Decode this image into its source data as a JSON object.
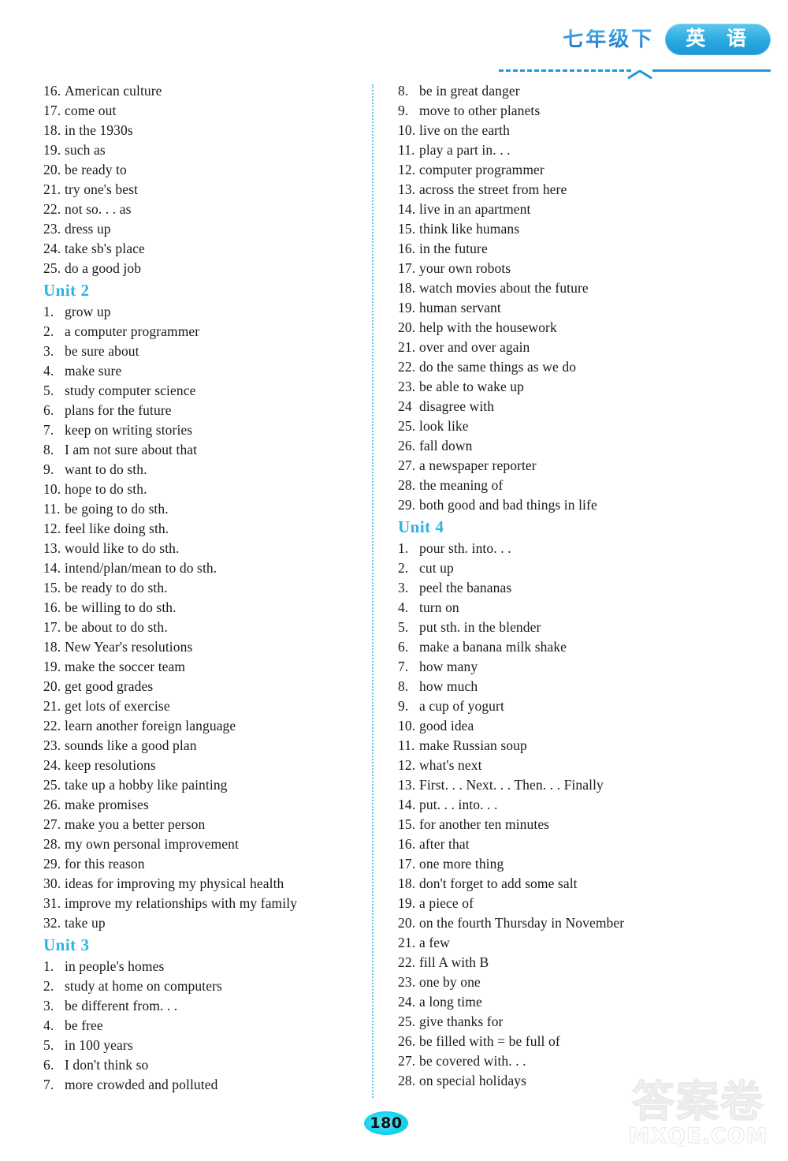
{
  "header": {
    "grade": "七年级下",
    "subject": "英 语"
  },
  "footer": {
    "page_number": "180",
    "watermark_cn": "答案卷",
    "watermark_domain": "MXQE.COM"
  },
  "colors": {
    "accent_blue": "#2bb3e6",
    "header_blue": "#1f7fd0",
    "divider": "#63c6ea",
    "page_badge": "#17d2ee",
    "text": "#1a1a1a"
  },
  "left_column": [
    {
      "type": "entry",
      "num": "16.",
      "text": "American culture"
    },
    {
      "type": "entry",
      "num": "17.",
      "text": "come out"
    },
    {
      "type": "entry",
      "num": "18.",
      "text": "in the 1930s"
    },
    {
      "type": "entry",
      "num": "19.",
      "text": "such as"
    },
    {
      "type": "entry",
      "num": "20.",
      "text": "be ready to"
    },
    {
      "type": "entry",
      "num": "21.",
      "text": "try one's best"
    },
    {
      "type": "entry",
      "num": "22.",
      "text": "not so. . . as"
    },
    {
      "type": "entry",
      "num": "23.",
      "text": "dress up"
    },
    {
      "type": "entry",
      "num": "24.",
      "text": "take sb's place"
    },
    {
      "type": "entry",
      "num": "25.",
      "text": "do a good job"
    },
    {
      "type": "unit",
      "label": "Unit",
      "num": "2"
    },
    {
      "type": "entry",
      "num": "1.",
      "text": "grow up"
    },
    {
      "type": "entry",
      "num": "2.",
      "text": "a computer programmer"
    },
    {
      "type": "entry",
      "num": "3.",
      "text": "be sure about"
    },
    {
      "type": "entry",
      "num": "4.",
      "text": "make sure"
    },
    {
      "type": "entry",
      "num": "5.",
      "text": "study computer science"
    },
    {
      "type": "entry",
      "num": "6.",
      "text": "plans for the future"
    },
    {
      "type": "entry",
      "num": "7.",
      "text": "keep on writing stories"
    },
    {
      "type": "entry",
      "num": "8.",
      "text": "I am not sure about that"
    },
    {
      "type": "entry",
      "num": "9.",
      "text": "want to do sth."
    },
    {
      "type": "entry",
      "num": "10.",
      "text": "hope to do sth."
    },
    {
      "type": "entry",
      "num": "11.",
      "text": "be going to do sth."
    },
    {
      "type": "entry",
      "num": "12.",
      "text": "feel like doing sth."
    },
    {
      "type": "entry",
      "num": "13.",
      "text": "would like to do sth."
    },
    {
      "type": "entry",
      "num": "14.",
      "text": "intend/plan/mean to do sth."
    },
    {
      "type": "entry",
      "num": "15.",
      "text": "be ready to do sth."
    },
    {
      "type": "entry",
      "num": "16.",
      "text": "be willing to do sth."
    },
    {
      "type": "entry",
      "num": "17.",
      "text": "be about to do sth."
    },
    {
      "type": "entry",
      "num": "18.",
      "text": "New Year's resolutions"
    },
    {
      "type": "entry",
      "num": "19.",
      "text": "make the soccer team"
    },
    {
      "type": "entry",
      "num": "20.",
      "text": "get good grades"
    },
    {
      "type": "entry",
      "num": "21.",
      "text": "get lots of exercise"
    },
    {
      "type": "entry",
      "num": "22.",
      "text": "learn another foreign language"
    },
    {
      "type": "entry",
      "num": "23.",
      "text": "sounds like a good plan"
    },
    {
      "type": "entry",
      "num": "24.",
      "text": "keep resolutions"
    },
    {
      "type": "entry",
      "num": "25.",
      "text": "take up a hobby like painting"
    },
    {
      "type": "entry",
      "num": "26.",
      "text": "make promises"
    },
    {
      "type": "entry",
      "num": "27.",
      "text": "make you a better person"
    },
    {
      "type": "entry",
      "num": "28.",
      "text": "my own personal improvement"
    },
    {
      "type": "entry",
      "num": "29.",
      "text": "for this reason"
    },
    {
      "type": "entry",
      "num": "30.",
      "text": "ideas for improving my physical health"
    },
    {
      "type": "entry",
      "num": "31.",
      "text": "improve my relationships with my family"
    },
    {
      "type": "entry",
      "num": "32.",
      "text": "take up"
    },
    {
      "type": "unit",
      "label": "Unit",
      "num": "3"
    },
    {
      "type": "entry",
      "num": "1.",
      "text": "in people's homes"
    },
    {
      "type": "entry",
      "num": "2.",
      "text": "study at home on computers"
    },
    {
      "type": "entry",
      "num": "3.",
      "text": "be different from. . ."
    },
    {
      "type": "entry",
      "num": "4.",
      "text": "be free"
    },
    {
      "type": "entry",
      "num": "5.",
      "text": "in 100 years"
    },
    {
      "type": "entry",
      "num": "6.",
      "text": "I don't think so"
    },
    {
      "type": "entry",
      "num": "7.",
      "text": "more crowded and polluted"
    }
  ],
  "right_column": [
    {
      "type": "entry",
      "num": "8.",
      "text": "be in great danger"
    },
    {
      "type": "entry",
      "num": "9.",
      "text": "move to other planets"
    },
    {
      "type": "entry",
      "num": "10.",
      "text": "live on the earth"
    },
    {
      "type": "entry",
      "num": "11.",
      "text": "play a part in. . ."
    },
    {
      "type": "entry",
      "num": "12.",
      "text": "computer programmer"
    },
    {
      "type": "entry",
      "num": "13.",
      "text": "across the street from here"
    },
    {
      "type": "entry",
      "num": "14.",
      "text": "live in an apartment"
    },
    {
      "type": "entry",
      "num": "15.",
      "text": "think like humans"
    },
    {
      "type": "entry",
      "num": "16.",
      "text": "in the future"
    },
    {
      "type": "entry",
      "num": "17.",
      "text": "your own robots"
    },
    {
      "type": "entry",
      "num": "18.",
      "text": "watch movies about the future"
    },
    {
      "type": "entry",
      "num": "19.",
      "text": "human servant"
    },
    {
      "type": "entry",
      "num": "20.",
      "text": "help with the housework"
    },
    {
      "type": "entry",
      "num": "21.",
      "text": "over and over again"
    },
    {
      "type": "entry",
      "num": "22.",
      "text": "do the same things as we do"
    },
    {
      "type": "entry",
      "num": "23.",
      "text": "be able to wake up"
    },
    {
      "type": "entry",
      "num": "24",
      "text": "disagree with"
    },
    {
      "type": "entry",
      "num": "25.",
      "text": "look like"
    },
    {
      "type": "entry",
      "num": "26.",
      "text": "fall down"
    },
    {
      "type": "entry",
      "num": "27.",
      "text": "a newspaper reporter"
    },
    {
      "type": "entry",
      "num": "28.",
      "text": "the meaning of"
    },
    {
      "type": "entry",
      "num": "29.",
      "text": "both good and bad things in life"
    },
    {
      "type": "unit",
      "label": "Unit",
      "num": "4"
    },
    {
      "type": "entry",
      "num": "1.",
      "text": "pour sth.  into. . ."
    },
    {
      "type": "entry",
      "num": "2.",
      "text": "cut up"
    },
    {
      "type": "entry",
      "num": "3.",
      "text": "peel the bananas"
    },
    {
      "type": "entry",
      "num": "4.",
      "text": "turn on"
    },
    {
      "type": "entry",
      "num": "5.",
      "text": "put sth.  in the blender"
    },
    {
      "type": "entry",
      "num": "6.",
      "text": "make a banana milk shake"
    },
    {
      "type": "entry",
      "num": "7.",
      "text": "how many"
    },
    {
      "type": "entry",
      "num": "8.",
      "text": "how much"
    },
    {
      "type": "entry",
      "num": "9.",
      "text": "a cup of yogurt"
    },
    {
      "type": "entry",
      "num": "10.",
      "text": "good idea"
    },
    {
      "type": "entry",
      "num": "11.",
      "text": "make Russian soup"
    },
    {
      "type": "entry",
      "num": "12.",
      "text": "what's next"
    },
    {
      "type": "entry",
      "num": "13.",
      "text": "First. . . Next. . . Then. . . Finally"
    },
    {
      "type": "entry",
      "num": "14.",
      "text": "put. . . into. . ."
    },
    {
      "type": "entry",
      "num": "15.",
      "text": "for another ten minutes"
    },
    {
      "type": "entry",
      "num": "16.",
      "text": "after that"
    },
    {
      "type": "entry",
      "num": "17.",
      "text": "one more thing"
    },
    {
      "type": "entry",
      "num": "18.",
      "text": "don't forget to add some salt"
    },
    {
      "type": "entry",
      "num": "19.",
      "text": "a piece of"
    },
    {
      "type": "entry",
      "num": "20.",
      "text": "on the fourth Thursday in November"
    },
    {
      "type": "entry",
      "num": "21.",
      "text": "a few"
    },
    {
      "type": "entry",
      "num": "22.",
      "text": "fill A with B"
    },
    {
      "type": "entry",
      "num": "23.",
      "text": "one by one"
    },
    {
      "type": "entry",
      "num": "24.",
      "text": "a long time"
    },
    {
      "type": "entry",
      "num": "25.",
      "text": "give thanks for"
    },
    {
      "type": "entry",
      "num": "26.",
      "text": "be filled with = be full of"
    },
    {
      "type": "entry",
      "num": "27.",
      "text": "be covered with. . ."
    },
    {
      "type": "entry",
      "num": "28.",
      "text": "on special holidays"
    }
  ]
}
